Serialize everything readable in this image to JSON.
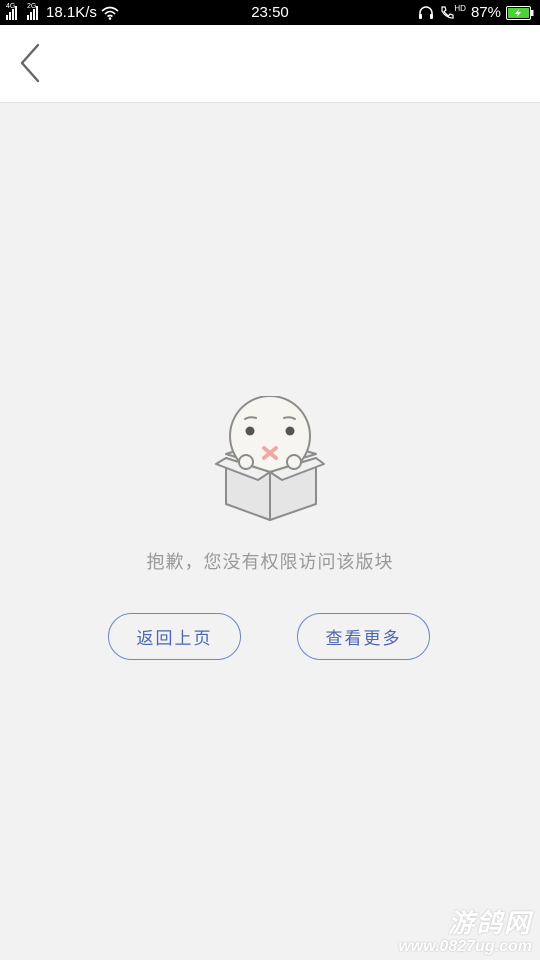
{
  "status_bar": {
    "network_1": "4G",
    "network_2": "2G",
    "speed": "18.1K/s",
    "time": "23:50",
    "hd_label": "HD",
    "battery": "87%",
    "battery_color": "#4cd137"
  },
  "header": {
    "back_icon": "chevron-left-icon"
  },
  "empty_state": {
    "illustration": "face-in-box-illustration",
    "message": "抱歉，您没有权限访问该版块"
  },
  "actions": {
    "back_label": "返回上页",
    "more_label": "查看更多",
    "accent_color": "#4c66b0"
  },
  "watermark": {
    "logo": "游鸽网",
    "url": "www.0827ug.com"
  }
}
